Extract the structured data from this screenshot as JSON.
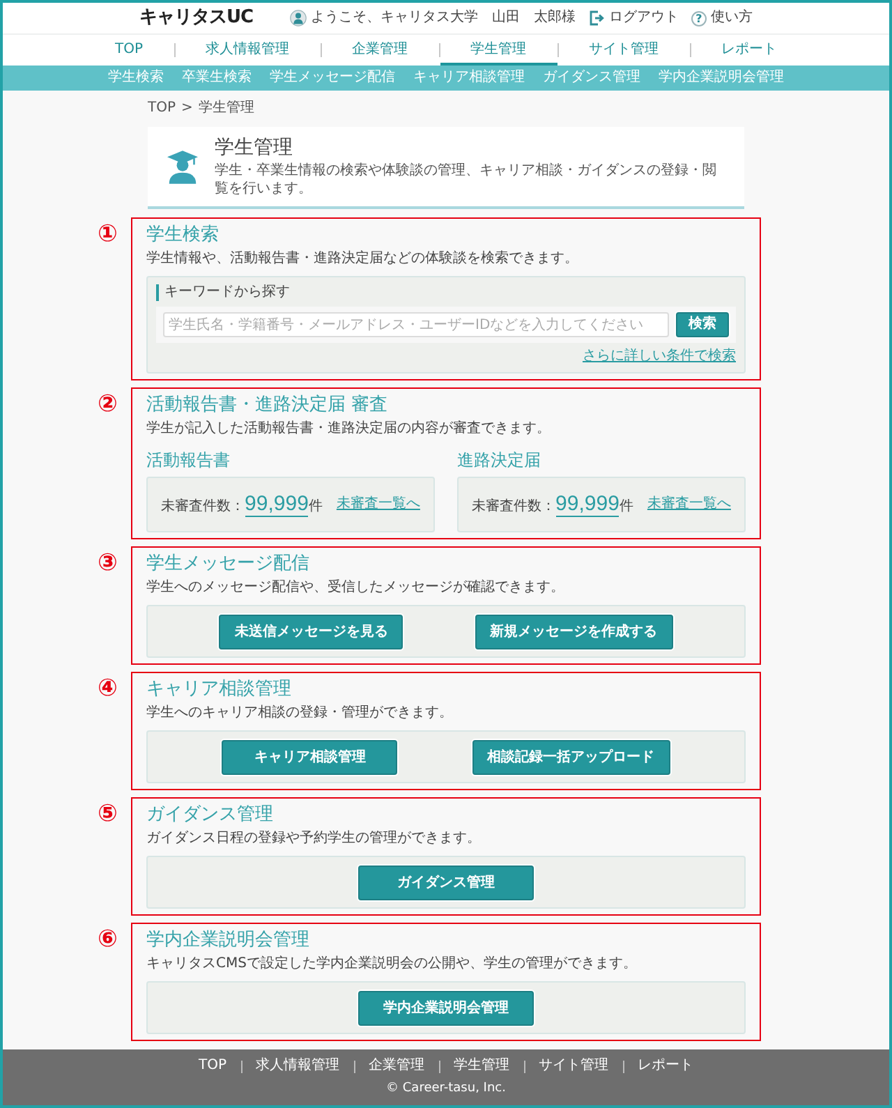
{
  "header": {
    "logo": "キャリタスUC",
    "welcome": "ようこそ、キャリタス大学　山田　太郎様",
    "logout": "ログアウト",
    "help_icon": "?",
    "help": "使い方"
  },
  "main_nav": [
    {
      "label": "TOP",
      "selected": false
    },
    {
      "label": "求人情報管理",
      "selected": false
    },
    {
      "label": "企業管理",
      "selected": false
    },
    {
      "label": "学生管理",
      "selected": true
    },
    {
      "label": "サイト管理",
      "selected": false
    },
    {
      "label": "レポート",
      "selected": false
    }
  ],
  "sub_nav": [
    "学生検索",
    "卒業生検索",
    "学生メッセージ配信",
    "キャリア相談管理",
    "ガイダンス管理",
    "学内企業説明会管理"
  ],
  "breadcrumb": {
    "items": [
      "TOP",
      "学生管理"
    ],
    "separator": ">"
  },
  "page_header": {
    "title": "学生管理",
    "description": "学生・卒業生情報の検索や体験談の管理、キャリア相談・ガイダンスの登録・閲覧を行います。"
  },
  "sections": [
    {
      "marker": "①",
      "kind": "search",
      "title": "学生検索",
      "description": "学生情報や、活動報告書・進路決定届などの体験談を検索できます。",
      "search": {
        "label": "キーワードから探す",
        "placeholder": "学生氏名・学籍番号・メールアドレス・ユーザーIDなどを入力してください",
        "button": "検索",
        "link": "さらに詳しい条件で検索"
      }
    },
    {
      "marker": "②",
      "kind": "review",
      "title": "活動報告書・進路決定届 審査",
      "description": "学生が記入した活動報告書・進路決定届の内容が審査できます。",
      "columns": [
        {
          "heading": "活動報告書",
          "count_label": "未審査件数：",
          "count": "99,999",
          "unit": "件",
          "link": "未審査一覧へ"
        },
        {
          "heading": "進路決定届",
          "count_label": "未審査件数：",
          "count": "99,999",
          "unit": "件",
          "link": "未審査一覧へ"
        }
      ]
    },
    {
      "marker": "③",
      "kind": "buttons",
      "title": "学生メッセージ配信",
      "description": "学生へのメッセージ配信や、受信したメッセージが確認できます。",
      "buttons": [
        "未送信メッセージを見る",
        "新規メッセージを作成する"
      ]
    },
    {
      "marker": "④",
      "kind": "buttons",
      "title": "キャリア相談管理",
      "description": "学生へのキャリア相談の登録・管理ができます。",
      "buttons": [
        "キャリア相談管理",
        "相談記録一括アップロード"
      ]
    },
    {
      "marker": "⑤",
      "kind": "buttons",
      "title": "ガイダンス管理",
      "description": "ガイダンス日程の登録や予約学生の管理ができます。",
      "buttons": [
        "ガイダンス管理"
      ]
    },
    {
      "marker": "⑥",
      "kind": "buttons",
      "title": "学内企業説明会管理",
      "description": "キャリタスCMSで設定した学内企業説明会の公開や、学生の管理ができます。",
      "buttons": [
        "学内企業説明会管理"
      ]
    }
  ],
  "footer": {
    "links": [
      "TOP",
      "求人情報管理",
      "企業管理",
      "学生管理",
      "サイト管理",
      "レポート"
    ],
    "copyright": "© Career-tasu, Inc."
  }
}
